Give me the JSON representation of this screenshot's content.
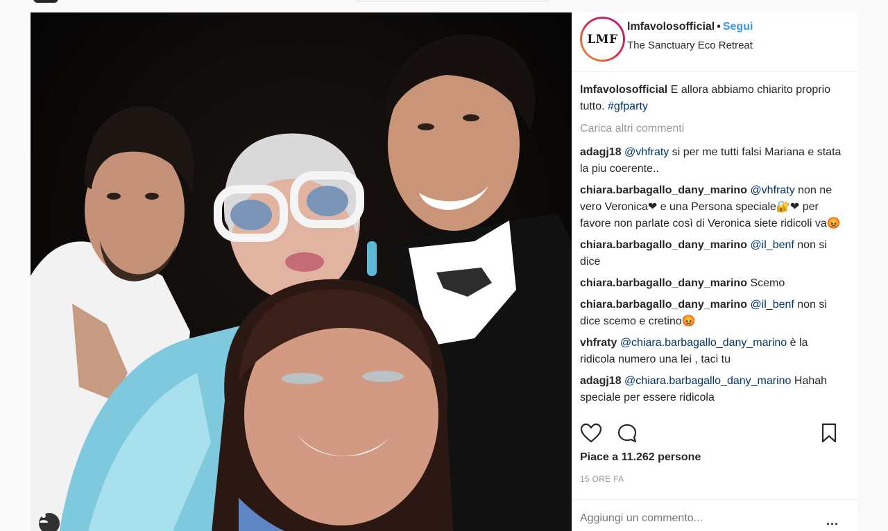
{
  "post": {
    "username": "lmfavolosofficial",
    "follow_label": "Segui",
    "location": "The Sanctuary Eco Retreat",
    "avatar_text": "LMF",
    "caption": {
      "user": "lmfavolosofficial",
      "text": "E allora abbiamo chiarito proprio tutto.",
      "hashtag": "#gfparty"
    },
    "load_more": "Carica altri commenti",
    "comments": [
      {
        "user": "adagj18",
        "mention": "@vhfraty",
        "text": "si per me tutti falsi Mariana e stata la piu coerente.."
      },
      {
        "user": "chiara.barbagallo_dany_marino",
        "mention": "@vhfraty",
        "text": "non ne vero Veronica❤ e una Persona speciale🔐❤ per favore non parlate così di Veronica siete ridicoli va😡"
      },
      {
        "user": "chiara.barbagallo_dany_marino",
        "mention": "@il_benf",
        "text": "non si dice"
      },
      {
        "user": "chiara.barbagallo_dany_marino",
        "mention": "",
        "text": "Scemo"
      },
      {
        "user": "chiara.barbagallo_dany_marino",
        "mention": "@il_benf",
        "text": "non si dice scemo e cretino😡"
      },
      {
        "user": "vhfraty",
        "mention": "@chiara.barbagallo_dany_marino",
        "text": "è la ridicola numero una lei , taci tu"
      },
      {
        "user": "adagj18",
        "mention": "@chiara.barbagallo_dany_marino",
        "text": "Hahah speciale per essere ridicola"
      }
    ],
    "likes": "Piace a 11.262 persone",
    "time_ago": "15 ORE FA",
    "add_comment_placeholder": "Aggiungi un commento...",
    "more_options": "..."
  },
  "icons": {
    "like": "heart-icon",
    "comment": "comment-icon",
    "save": "bookmark-icon",
    "user_tag": "person-icon"
  }
}
